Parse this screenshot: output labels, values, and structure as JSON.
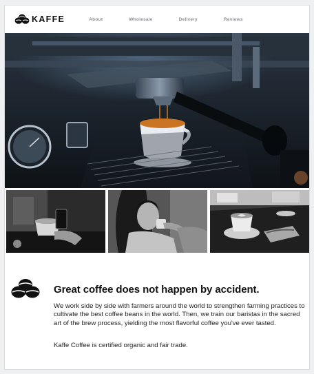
{
  "brand": {
    "name": "KAFFE",
    "logo_icon": "coffee-beans-icon"
  },
  "nav": {
    "links": [
      {
        "label": "About"
      },
      {
        "label": "Wholesale"
      },
      {
        "label": "Delivery"
      },
      {
        "label": "Reviews"
      }
    ]
  },
  "hero": {
    "icon": "espresso-machine-photo"
  },
  "thumbnails": [
    {
      "icon": "latte-cup-phone-photo"
    },
    {
      "icon": "woman-drinking-coffee-photo"
    },
    {
      "icon": "latte-art-table-photo"
    }
  ],
  "info": {
    "icon": "coffee-beans-icon",
    "headline": "Great coffee does not happen by accident.",
    "paragraph1": "We work side by side with farmers around the world to strengthen farming practices to cultivate the best coffee beans in the world. Then, we train our baristas in the sacred art of the brew process, yielding the most flavorful coffee you've ever tasted.",
    "paragraph2": "Kaffe Coffee is certified organic and fair trade."
  },
  "colors": {
    "page_bg": "#eef0f2",
    "card_bg": "#ffffff",
    "nav_link": "#8c8f94",
    "text": "#111111"
  }
}
